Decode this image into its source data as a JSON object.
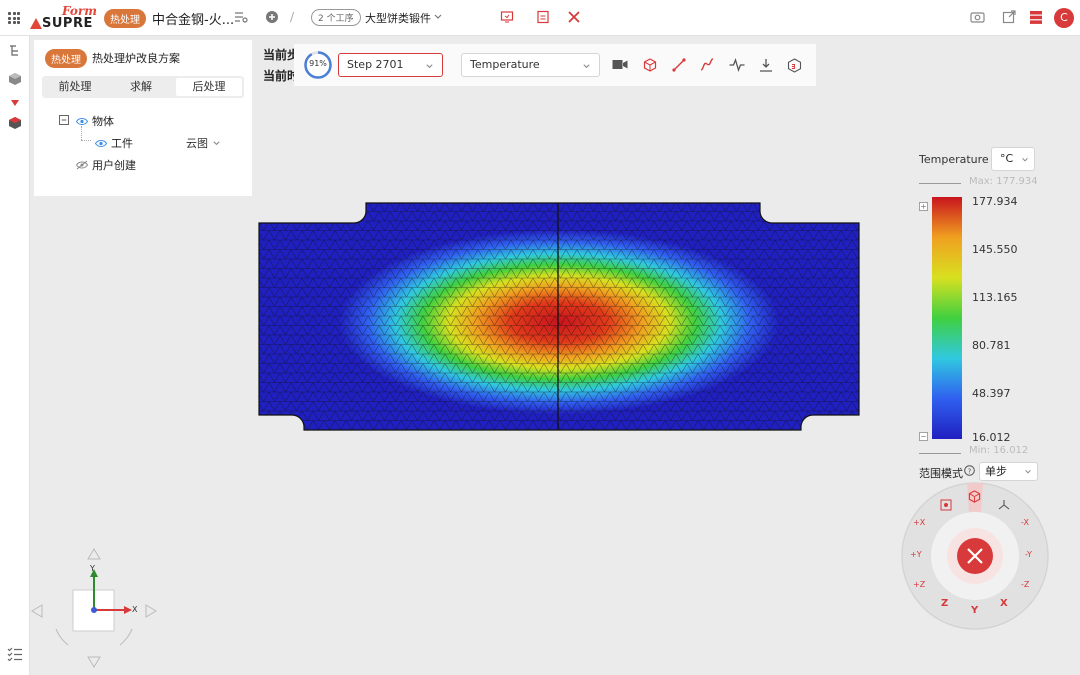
{
  "header": {
    "logo_brand": "SUPRE",
    "logo_script": "Form",
    "module_badge": "热处理",
    "project_title": "中合金钢-火...",
    "steps_badge": "2 个工序",
    "part_name": "大型饼类锻件",
    "avatar_letter": "C"
  },
  "panel": {
    "badge": "热处理",
    "title": "热处理炉改良方案",
    "tabs": [
      "前处理",
      "求解",
      "后处理"
    ],
    "active_tab": "后处理",
    "tree": {
      "root": "物体",
      "child": "工件",
      "child_mode": "云图",
      "user": "用户创建"
    }
  },
  "overlay": {
    "line1": "当前步",
    "line2": "当前时"
  },
  "toolbar": {
    "progress_label": "91%",
    "progress": 0.91,
    "step_select": "Step 2701",
    "field_select": "Temperature"
  },
  "legend": {
    "title": "Temperature",
    "unit": "°C",
    "max_label": "Max: 177.934",
    "min_label": "Min: 16.012",
    "ticks": [
      "177.934",
      "145.550",
      "113.165",
      "80.781",
      "48.397",
      "16.012"
    ],
    "range_label": "范围模式",
    "range_value": "单步",
    "colors": [
      "#c8141e",
      "#f0a020",
      "#d8e020",
      "#40d040",
      "#30c8e0",
      "#3060f0",
      "#2020c0"
    ]
  },
  "wheel": {
    "buttons": [
      "+X",
      "-X",
      "+Y",
      "-Y",
      "+Z",
      "-Z"
    ],
    "axes": [
      "Z",
      "Y",
      "X"
    ]
  },
  "axes_gizmo": {
    "x": "X",
    "y": "Y"
  }
}
